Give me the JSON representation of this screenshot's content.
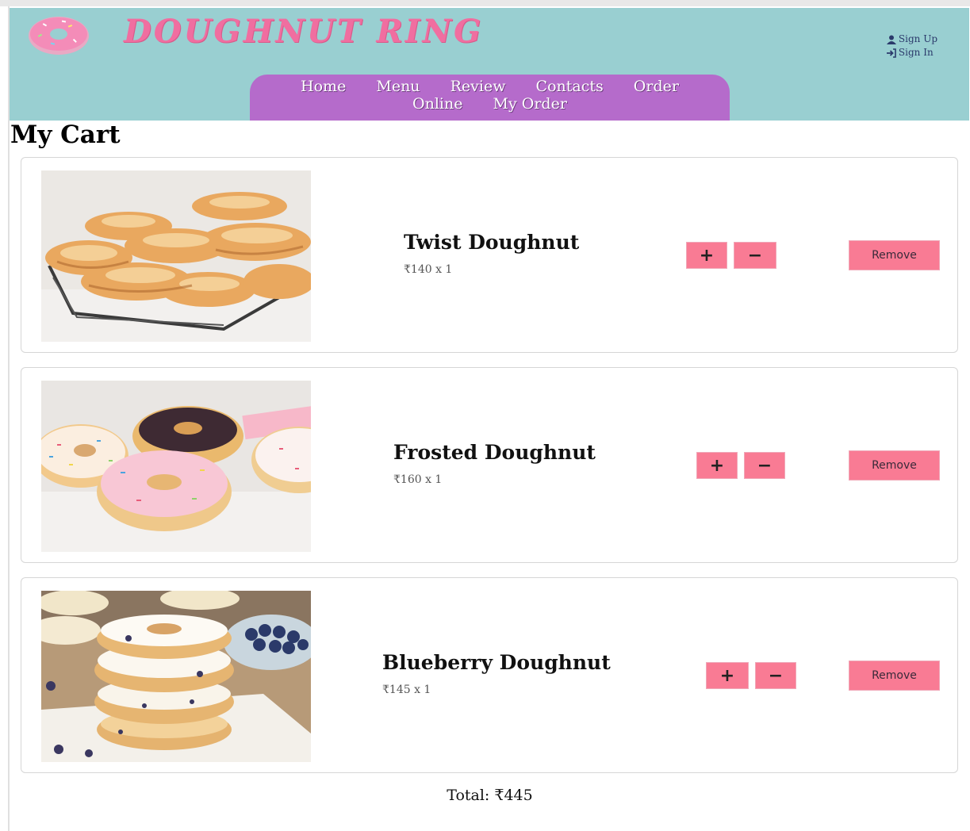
{
  "brand": {
    "name": "DOUGHNUT RING",
    "logo_icon": "doughnut-logo-icon",
    "color": "#f06ea0"
  },
  "header": {
    "background": "#99cfd1"
  },
  "auth": {
    "sign_up": "Sign Up",
    "sign_in": "Sign In",
    "sign_up_icon": "user-icon",
    "sign_in_icon": "sign-in-icon"
  },
  "nav": {
    "background": "#b56bcb",
    "items": [
      "Home",
      "Menu",
      "Review",
      "Contacts",
      "Order Online",
      "My Order"
    ]
  },
  "page": {
    "title": "My Cart"
  },
  "cart": {
    "items": [
      {
        "name": "Twist Doughnut",
        "price_line": "₹140 x 1",
        "image": "twist-doughnut-photo"
      },
      {
        "name": "Frosted Doughnut",
        "price_line": "₹160 x 1",
        "image": "frosted-doughnut-photo"
      },
      {
        "name": "Blueberry Doughnut",
        "price_line": "₹145 x 1",
        "image": "blueberry-doughnut-photo"
      }
    ],
    "plus_label": "+",
    "minus_label": "−",
    "remove_label": "Remove",
    "button_color": "#f97b94",
    "total_text": "Total: ₹445"
  }
}
